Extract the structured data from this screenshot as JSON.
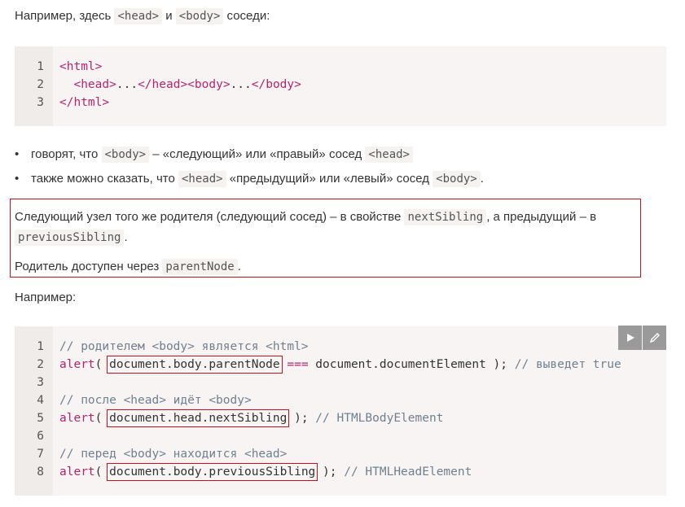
{
  "intro": {
    "text1": "Например, здесь",
    "code1": "<head>",
    "text2": "и",
    "code2": "<body>",
    "text3": "соседи:"
  },
  "code_block_1": {
    "lines": [
      {
        "num": "1",
        "parts": [
          {
            "t": "<html>",
            "c": "tag"
          }
        ]
      },
      {
        "num": "2",
        "parts": [
          {
            "t": "  "
          },
          {
            "t": "<head>",
            "c": "tag"
          },
          {
            "t": "..."
          },
          {
            "t": "</head>",
            "c": "tag"
          },
          {
            "t": "<body>",
            "c": "tag"
          },
          {
            "t": "..."
          },
          {
            "t": "</body>",
            "c": "tag"
          }
        ]
      },
      {
        "num": "3",
        "parts": [
          {
            "t": "</html>",
            "c": "tag"
          }
        ]
      }
    ]
  },
  "bullets": [
    {
      "a": "говорят, что",
      "code1": "<body>",
      "b": "– «следующий» или «правый» сосед",
      "code2": "<head>",
      "c": ""
    },
    {
      "a": "также можно сказать, что",
      "code1": "<head>",
      "b": "«предыдущий» или «левый» сосед",
      "code2": "<body>",
      "c": "."
    }
  ],
  "callout": {
    "line1_a": "Следующий узел того же родителя (следующий сосед) – в свойстве",
    "line1_code": "nextSibling",
    "line1_b": ", а предыдущий – в",
    "line2_code": "previousSibling",
    "line2_b": ".",
    "line3_a": "Родитель доступен через",
    "line3_code": "parentNode",
    "line3_b": "."
  },
  "example_label": "Например:",
  "code_block_2": {
    "lines": [
      {
        "num": "1",
        "parts": [
          {
            "t": "// родителем <body> является <html>",
            "c": "cm"
          }
        ]
      },
      {
        "num": "2",
        "parts": [
          {
            "t": "alert",
            "c": "kw"
          },
          {
            "t": "( "
          },
          {
            "t": "document.body.parentNode",
            "box": true
          },
          {
            "t": " "
          },
          {
            "t": "===",
            "c": "op"
          },
          {
            "t": " document.documentElement ); "
          },
          {
            "t": "// выведет true",
            "c": "cm"
          }
        ]
      },
      {
        "num": "3",
        "parts": []
      },
      {
        "num": "4",
        "parts": [
          {
            "t": "// после <head> идёт <body>",
            "c": "cm"
          }
        ]
      },
      {
        "num": "5",
        "parts": [
          {
            "t": "alert",
            "c": "kw"
          },
          {
            "t": "( "
          },
          {
            "t": "document.head.nextSibling",
            "box": true
          },
          {
            "t": " ); "
          },
          {
            "t": "// HTMLBodyElement",
            "c": "cm"
          }
        ]
      },
      {
        "num": "6",
        "parts": []
      },
      {
        "num": "7",
        "parts": [
          {
            "t": "// перед <body> находится <head>",
            "c": "cm"
          }
        ]
      },
      {
        "num": "8",
        "parts": [
          {
            "t": "alert",
            "c": "kw"
          },
          {
            "t": "( "
          },
          {
            "t": "document.body.previousSibling",
            "box": true
          },
          {
            "t": " ); "
          },
          {
            "t": "// HTMLHeadElement",
            "c": "cm"
          }
        ]
      }
    ],
    "run_icon": "play-icon",
    "edit_icon": "pencil-icon"
  }
}
